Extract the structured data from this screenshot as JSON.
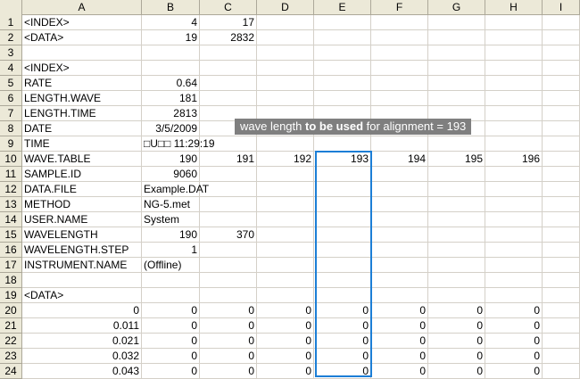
{
  "columns": [
    "A",
    "B",
    "C",
    "D",
    "E",
    "F",
    "G",
    "H",
    "I"
  ],
  "rows": [
    {
      "n": "1",
      "cells": [
        "<INDEX>",
        "4",
        "17",
        "",
        "",
        "",
        "",
        "",
        ""
      ]
    },
    {
      "n": "2",
      "cells": [
        "<DATA>",
        "19",
        "2832",
        "",
        "",
        "",
        "",
        "",
        ""
      ]
    },
    {
      "n": "3",
      "cells": [
        "",
        "",
        "",
        "",
        "",
        "",
        "",
        "",
        ""
      ]
    },
    {
      "n": "4",
      "cells": [
        "<INDEX>",
        "",
        "",
        "",
        "",
        "",
        "",
        "",
        ""
      ]
    },
    {
      "n": "5",
      "cells": [
        "RATE",
        "0.64",
        "",
        "",
        "",
        "",
        "",
        "",
        ""
      ]
    },
    {
      "n": "6",
      "cells": [
        "LENGTH.WAVE",
        "181",
        "",
        "",
        "",
        "",
        "",
        "",
        ""
      ]
    },
    {
      "n": "7",
      "cells": [
        "LENGTH.TIME",
        "2813",
        "",
        "",
        "",
        "",
        "",
        "",
        ""
      ]
    },
    {
      "n": "8",
      "cells": [
        "DATE",
        "3/5/2009",
        "",
        "",
        "",
        "",
        "",
        "",
        ""
      ]
    },
    {
      "n": "9",
      "cells": [
        "TIME",
        "□U□□ 11:29:19",
        "",
        "",
        "",
        "",
        "",
        "",
        ""
      ]
    },
    {
      "n": "10",
      "cells": [
        "WAVE.TABLE",
        "190",
        "191",
        "192",
        "193",
        "194",
        "195",
        "196",
        ""
      ]
    },
    {
      "n": "11",
      "cells": [
        "SAMPLE.ID",
        "9060",
        "",
        "",
        "",
        "",
        "",
        "",
        ""
      ]
    },
    {
      "n": "12",
      "cells": [
        "DATA.FILE",
        "Example.DAT",
        "",
        "",
        "",
        "",
        "",
        "",
        ""
      ]
    },
    {
      "n": "13",
      "cells": [
        "METHOD",
        "NG-5.met",
        "",
        "",
        "",
        "",
        "",
        "",
        ""
      ]
    },
    {
      "n": "14",
      "cells": [
        "USER.NAME",
        "System",
        "",
        "",
        "",
        "",
        "",
        "",
        ""
      ]
    },
    {
      "n": "15",
      "cells": [
        "WAVELENGTH",
        "190",
        "370",
        "",
        "",
        "",
        "",
        "",
        ""
      ]
    },
    {
      "n": "16",
      "cells": [
        "WAVELENGTH.STEP",
        "1",
        "",
        "",
        "",
        "",
        "",
        "",
        ""
      ]
    },
    {
      "n": "17",
      "cells": [
        "INSTRUMENT.NAME",
        "(Offline)",
        "",
        "",
        "",
        "",
        "",
        "",
        ""
      ]
    },
    {
      "n": "18",
      "cells": [
        "",
        "",
        "",
        "",
        "",
        "",
        "",
        "",
        ""
      ]
    },
    {
      "n": "19",
      "cells": [
        "<DATA>",
        "",
        "",
        "",
        "",
        "",
        "",
        "",
        ""
      ]
    },
    {
      "n": "20",
      "cells": [
        "0",
        "0",
        "0",
        "0",
        "0",
        "0",
        "0",
        "0",
        ""
      ]
    },
    {
      "n": "21",
      "cells": [
        "0.011",
        "0",
        "0",
        "0",
        "0",
        "0",
        "0",
        "0",
        ""
      ]
    },
    {
      "n": "22",
      "cells": [
        "0.021",
        "0",
        "0",
        "0",
        "0",
        "0",
        "0",
        "0",
        ""
      ]
    },
    {
      "n": "23",
      "cells": [
        "0.032",
        "0",
        "0",
        "0",
        "0",
        "0",
        "0",
        "0",
        ""
      ]
    },
    {
      "n": "24",
      "cells": [
        "0.043",
        "0",
        "0",
        "0",
        "0",
        "0",
        "0",
        "0",
        ""
      ]
    }
  ],
  "callout": {
    "part1": "wave length ",
    "part2": "to be used",
    "part3": " for alignment = 193"
  },
  "colors": {
    "header_bg": "#ece9d8",
    "grid_line": "#d4d0c8",
    "callout_bg": "#7f7f7f",
    "selection_border": "#1c7ed6"
  }
}
